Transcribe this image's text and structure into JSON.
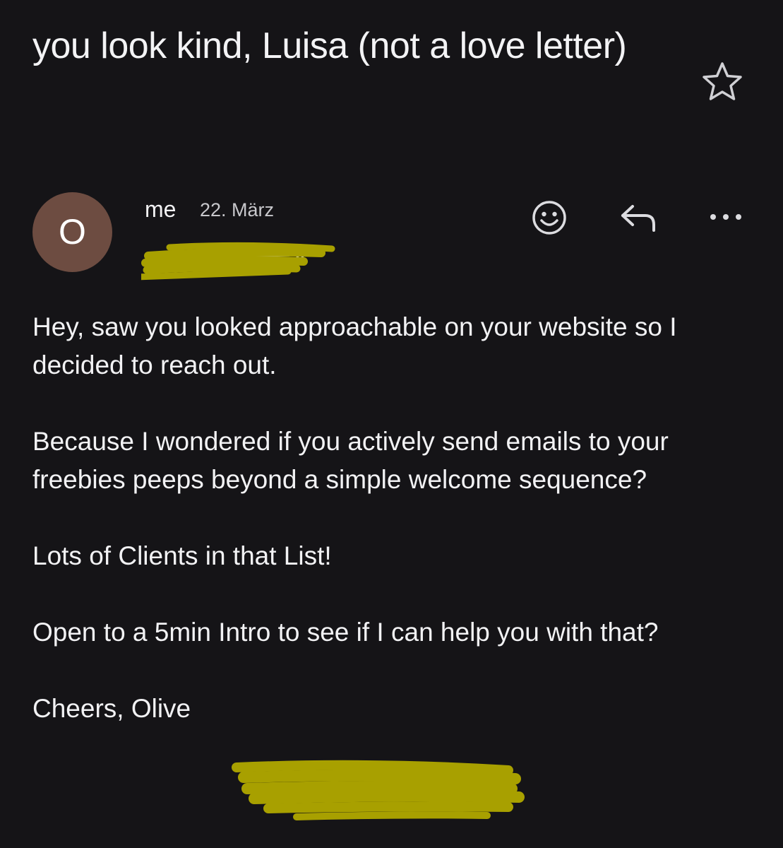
{
  "email": {
    "subject": "you look kind, Luisa (not a love letter)",
    "sender": "me",
    "date": "22. März",
    "avatar_initial": "O",
    "body_paragraphs": [
      "Hey, saw you looked approachable on your website so I decided to reach out.",
      "Because I wondered if you actively send emails to your freebies peeps beyond a simple welcome sequence?",
      "Lots of Clients in that List!",
      "Open to a 5min Intro to see if I can help you with that?",
      "Cheers, Olive"
    ]
  },
  "icons": {
    "star": "star-icon",
    "emoji": "emoji-reaction-icon",
    "reply": "reply-icon",
    "more": "more-options-icon",
    "expand": "chevron-down-icon"
  },
  "colors": {
    "background": "#151417",
    "avatar": "#6d4c41",
    "redaction_highlighter": "#a8a000",
    "text": "#f2f2f4"
  }
}
